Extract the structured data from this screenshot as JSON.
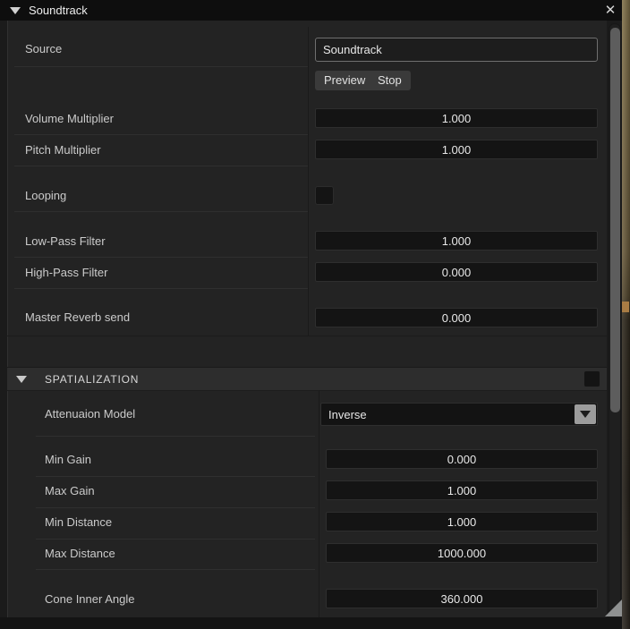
{
  "window": {
    "title": "Soundtrack",
    "collapse_icon": "triangle-down",
    "close_label": "✕"
  },
  "source": {
    "label": "Source",
    "value": "Soundtrack",
    "preview_label": "Preview",
    "stop_label": "Stop"
  },
  "fields": {
    "volume": {
      "label": "Volume Multiplier",
      "value": "1.000"
    },
    "pitch": {
      "label": "Pitch Multiplier",
      "value": "1.000"
    },
    "looping": {
      "label": "Looping",
      "checked": false
    },
    "low_pass": {
      "label": "Low-Pass Filter",
      "value": "1.000"
    },
    "high_pass": {
      "label": "High-Pass Filter",
      "value": "0.000"
    },
    "master_reverb": {
      "label": "Master Reverb send",
      "value": "0.000"
    }
  },
  "spatialization": {
    "title": "SPATIALIZATION",
    "enabled": false,
    "attenuation": {
      "label": "Attenuaion Model",
      "value": "Inverse"
    },
    "min_gain": {
      "label": "Min Gain",
      "value": "0.000"
    },
    "max_gain": {
      "label": "Max Gain",
      "value": "1.000"
    },
    "min_distance": {
      "label": "Min Distance",
      "value": "1.000"
    },
    "max_distance": {
      "label": "Max Distance",
      "value": "1000.000"
    },
    "cone_inner_angle": {
      "label": "Cone Inner Angle",
      "value": "360.000"
    }
  },
  "colors": {
    "titlebar": "#0e0e0e",
    "panel": "#232323",
    "section_header": "#2d2d2d",
    "field_bg": "#141414",
    "button_bg": "#3a3a3a",
    "label_text": "#cbcbcb",
    "value_text": "#e8e8e8",
    "scroll_thumb": "#5d5d5d",
    "background_strip": "#84744c",
    "background_notch": "#a87c44"
  }
}
